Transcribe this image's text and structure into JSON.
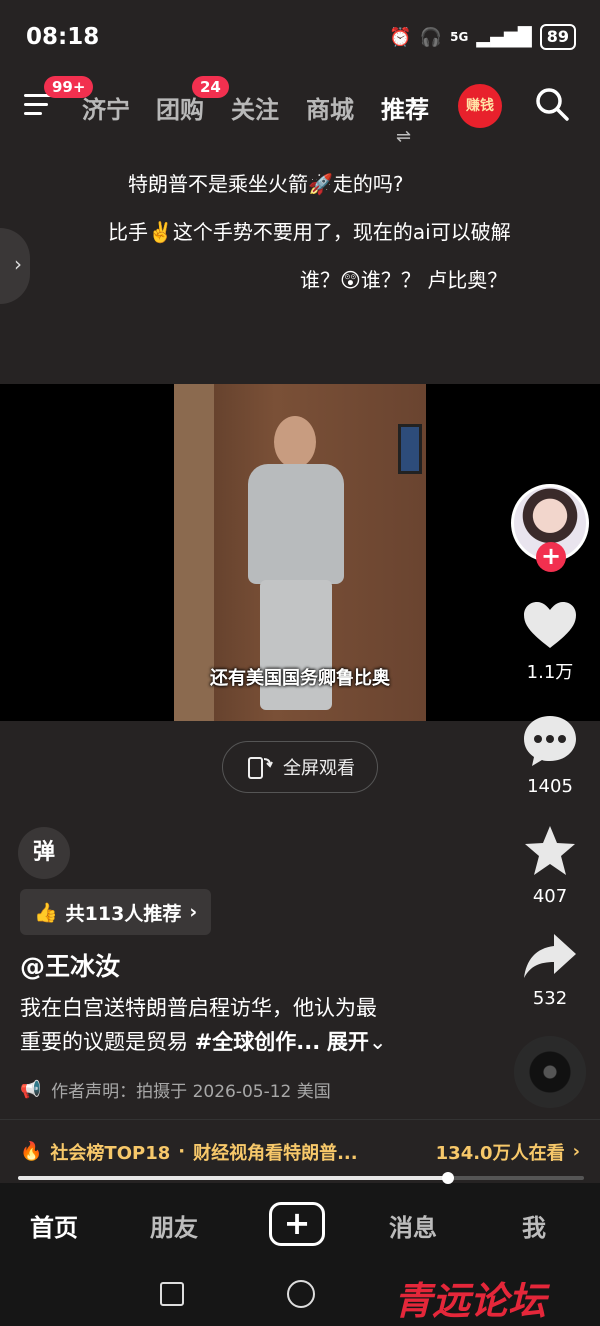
{
  "status": {
    "time": "08:18",
    "network": "5G",
    "battery": "89"
  },
  "nav": {
    "menu_badge": "99+",
    "tabs": [
      {
        "label": "济宁"
      },
      {
        "label": "团购",
        "badge": "24"
      },
      {
        "label": "关注"
      },
      {
        "label": "商城"
      },
      {
        "label": "推荐"
      }
    ],
    "tab_switch": "⇌",
    "earn_label": "赚钱"
  },
  "comments": [
    "特朗普不是乘坐火箭🚀走的吗?",
    "比手✌️这个手势不要用了，现在的ai可以破解",
    "谁？😲谁？？ 卢比奥？"
  ],
  "video": {
    "caption": "还有美国国务卿鲁比奥",
    "progress": 0.76
  },
  "fullscreen_label": "全屏观看",
  "danmu_label": "弹",
  "recommend_label": "共113人推荐",
  "author": "@王冰汝",
  "description": {
    "line1": "我在白宫送特朗普启程访华，他认为最",
    "line2_text": "重要的议题是贸易 ",
    "hashtag": "#全球创作...",
    "expand": "展开"
  },
  "declaration": "作者声明：拍摄于 2026-05-12 美国",
  "actions": {
    "likes": "1.1万",
    "comments": "1405",
    "favorites": "407",
    "shares": "532"
  },
  "hot": {
    "rank": "社会榜TOP18",
    "title": "财经视角看特朗普...",
    "watching": "134.0万人在看"
  },
  "bottom_nav": [
    "首页",
    "朋友",
    "消息",
    "我"
  ],
  "watermark": "青远论坛",
  "colors": {
    "accent_red": "#f2304f",
    "hot_gold": "#f7c86a",
    "background": "#262323"
  }
}
